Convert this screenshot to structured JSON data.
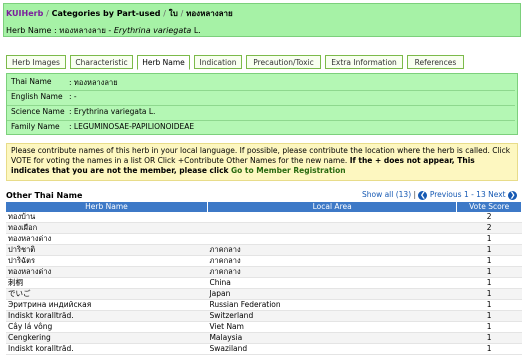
{
  "breadcrumb": {
    "root": "KUIHerb",
    "sep1": "/",
    "category": "Categories by Part-used",
    "sep2": "/",
    "part": "ใบ",
    "sep3": "/",
    "herb": "ทองหลางลาย"
  },
  "herb_name_line": {
    "label": "Herb Name :",
    "thai": "ทองหลางลาย",
    "dash": "-",
    "science": "Erythrina variegata",
    "author": "L."
  },
  "tabs": [
    {
      "label": "Herb Images"
    },
    {
      "label": "Characteristic"
    },
    {
      "label": "Herb Name"
    },
    {
      "label": "Indication"
    },
    {
      "label": "Precaution/Toxic"
    },
    {
      "label": "Extra Information"
    },
    {
      "label": "References"
    }
  ],
  "info": {
    "thai_name_label": "Thai Name",
    "thai_name_value": ": ทองหลางลาย",
    "english_name_label": "English Name",
    "english_name_value": ": -",
    "science_name_label": "Science Name",
    "science_name_value": ": Erythrina variegata L.",
    "family_name_label": "Family Name",
    "family_name_value": ": LEGUMINOSAE-PAPILIONOIDEAE"
  },
  "note": {
    "text": "Please contribute names of this herb in your local language. If possible, please contribute the location where the herb is called. Click VOTE for voting the names in a list OR Click +Contribute Other Names for the new name.",
    "bold": "If the + does not appear, This indicates that you are not the member, please click",
    "link": "Go to Member Registration"
  },
  "other": {
    "title": "Other Thai Name",
    "show_all": "Show all (13)",
    "bar": "|",
    "prev": "Previous",
    "range": "1 - 13",
    "next": "Next"
  },
  "table": {
    "headers": [
      "Herb Name",
      "Local Area",
      "Vote Score"
    ],
    "rows": [
      [
        "ทองบ้าน",
        "",
        "2"
      ],
      [
        "ทองเผือก",
        "",
        "2"
      ],
      [
        "ทองหลางด่าง",
        "",
        "1"
      ],
      [
        "ปาริชาติ",
        "ภาคกลาง",
        "1"
      ],
      [
        "ปาริฉัตร",
        "ภาคกลาง",
        "1"
      ],
      [
        "ทองหลางด่าง",
        "ภาคกลาง",
        "1"
      ],
      [
        "刺桐",
        "China",
        "1"
      ],
      [
        "でいご",
        "Japan",
        "1"
      ],
      [
        "Эритрина индийская",
        "Russian Federation",
        "1"
      ],
      [
        "Indiskt korallträd.",
        "Switzerland",
        "1"
      ],
      [
        "Cây lá vông",
        "Viet Nam",
        "1"
      ],
      [
        "Cengkering",
        "Malaysia",
        "1"
      ],
      [
        "Indiskt korallträd.",
        "Swaziland",
        "1"
      ]
    ]
  }
}
